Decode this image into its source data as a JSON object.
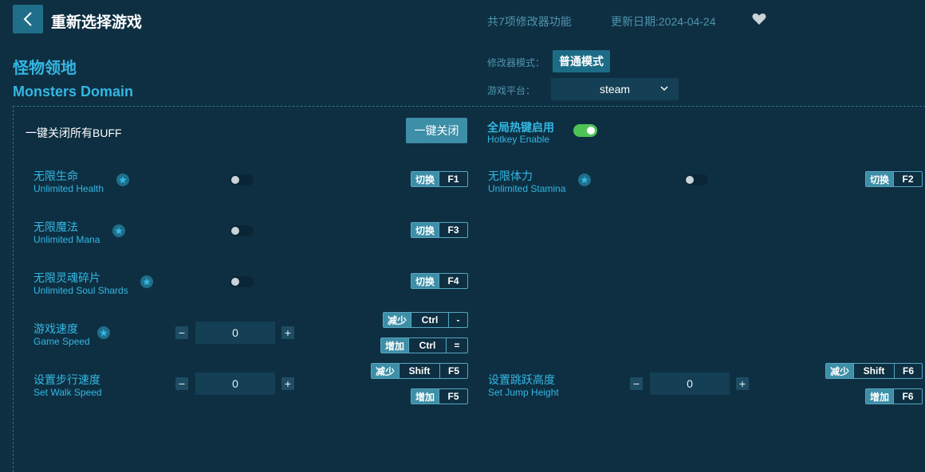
{
  "header": {
    "back_icon": "chevron-left-icon",
    "title": "重新选择游戏",
    "feature_count": "共7项修改器功能",
    "update_date": "更新日期:2024-04-24",
    "favorite_icon": "heart-icon"
  },
  "game": {
    "name_cn": "怪物领地",
    "name_en": "Monsters Domain"
  },
  "settings": {
    "mode_label": "修改器模式：",
    "mode_value": "普通模式",
    "platform_label": "游戏平台：",
    "platform_value": "steam"
  },
  "global": {
    "buff_label": "一键关闭所有BUFF",
    "close_all_label": "一键关闭",
    "hotkey_cn": "全局热键启用",
    "hotkey_en": "Hotkey Enable",
    "hotkey_enabled": true
  },
  "features": [
    {
      "cn": "无限生命",
      "en": "Unlimited Health",
      "action": "切换",
      "key": "F1",
      "on": false
    },
    {
      "cn": "无限体力",
      "en": "Unlimited Stamina",
      "action": "切换",
      "key": "F2",
      "on": false
    },
    {
      "cn": "无限魔法",
      "en": "Unlimited Mana",
      "action": "切换",
      "key": "F3",
      "on": false
    },
    {
      "cn": "无限灵魂碎片",
      "en": "Unlimited Soul Shards",
      "action": "切换",
      "key": "F4",
      "on": false
    }
  ],
  "numeric": [
    {
      "cn": "游戏速度",
      "en": "Game Speed",
      "value": "0",
      "dec": {
        "action": "减少",
        "mod": "Ctrl",
        "key": "-"
      },
      "inc": {
        "action": "增加",
        "mod": "Ctrl",
        "key": "="
      }
    },
    {
      "cn": "设置步行速度",
      "en": "Set Walk Speed",
      "value": "0",
      "dec": {
        "action": "减少",
        "mod": "Shift",
        "key": "F5"
      },
      "inc": {
        "action": "增加",
        "key": "F5"
      }
    },
    {
      "cn": "设置跳跃高度",
      "en": "Set Jump Height",
      "value": "0",
      "dec": {
        "action": "减少",
        "mod": "Shift",
        "key": "F6"
      },
      "inc": {
        "action": "增加",
        "key": "F6"
      }
    }
  ],
  "symbols": {
    "minus": "−",
    "plus": "+"
  },
  "colors": {
    "background": "#0e2f42",
    "accent": "#33b7e3",
    "button": "#3d8ea7",
    "toggle_on": "#4dc455"
  }
}
